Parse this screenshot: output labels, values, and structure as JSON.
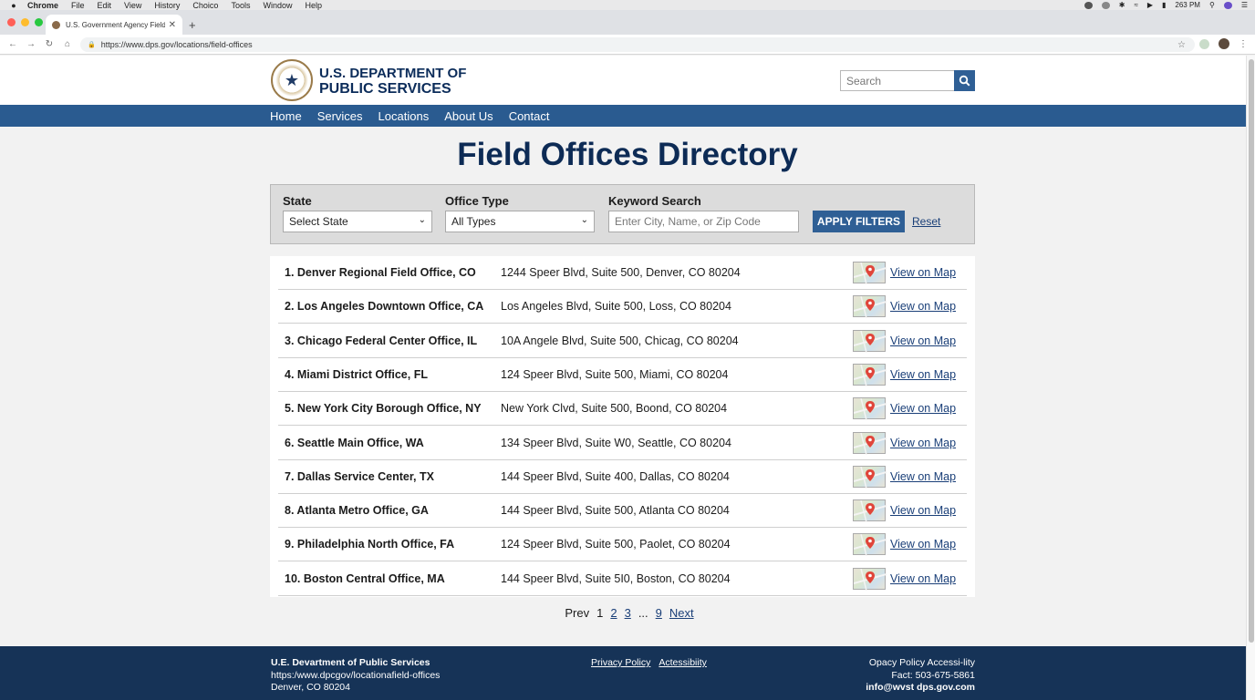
{
  "os_menubar": {
    "app": "Chrome",
    "items": [
      "File",
      "Edit",
      "View",
      "History",
      "Choico",
      "Tools",
      "Window",
      "Help"
    ],
    "clock": "263 PM"
  },
  "browser": {
    "tab_title": "U.S. Government Agency Field",
    "url": "https://www.dps.gov/locations/field-offices"
  },
  "site": {
    "brand_line1": "U.S. DEPARTMENT OF",
    "brand_line2": "PUBLIC SERVICES",
    "search_placeholder": "Search",
    "nav": [
      "Home",
      "Services",
      "Locations",
      "About Us",
      "Contact"
    ]
  },
  "page_title": "Field Offices Directory",
  "filters": {
    "state_label": "State",
    "state_value": "Select State",
    "type_label": "Office Type",
    "type_value": "All Types",
    "keyword_label": "Keyword Search",
    "keyword_placeholder": "Enter City, Name, or Zip Code",
    "apply_label": "APPLY FILTERS",
    "reset_label": "Reset"
  },
  "offices": [
    {
      "name": "1. Denver Regional Field Office, CO",
      "address": "1244 Speer Blvd, Suite 500, Denver, CO 80204",
      "map_label": "View on Map"
    },
    {
      "name": "2. Los Angeles Downtown Office, CA",
      "address": "Los Angeles Blvd, Suite 500, Loss, CO 80204",
      "map_label": "View on Map"
    },
    {
      "name": "3. Chicago Federal Center Office, IL",
      "address": "10A Angele Blvd, Suite 500, Chicag, CO 80204",
      "map_label": "View on Map"
    },
    {
      "name": "4. Miami District Office, FL",
      "address": "124 Speer Blvd, Suite 500, Miami, CO 80204",
      "map_label": "View on Map"
    },
    {
      "name": "5. New York City Borough Office, NY",
      "address": "New York Clvd, Suite 500, Boond, CO 80204",
      "map_label": "View on Map"
    },
    {
      "name": "6. Seattle Main Office, WA",
      "address": "134 Speer Blvd, Suite W0, Seattle, CO 80204",
      "map_label": "View on Map"
    },
    {
      "name": "7. Dallas Service Center, TX",
      "address": "144 Speer Blvd, Suite 400, Dallas, CO 80204",
      "map_label": "View on Map"
    },
    {
      "name": "8. Atlanta Metro Office, GA",
      "address": "144 Speer Blvd, Suite 500, Atlanta CO 80204",
      "map_label": "View on Map"
    },
    {
      "name": "9. Philadelphia North Office, FA",
      "address": "124 Speer Blvd, Suite 500, Paolet, CO 80204",
      "map_label": "View on Map"
    },
    {
      "name": "10. Boston Central Office, MA",
      "address": "144 Speer Blvd, Suite 5I0, Boston, CO 80204",
      "map_label": "View on Map"
    }
  ],
  "pagination": {
    "prev": "Prev",
    "pages": [
      "1",
      "2",
      "3",
      "...",
      "9"
    ],
    "next": "Next"
  },
  "footer": {
    "org": "U.E. Devartment of Public Services",
    "url": "https:/www.dpcgov/locationafield-offices",
    "city": "Denver, CO 80204",
    "privacy": "Privacy Policy",
    "accessibility": "Actessibiity",
    "right_links": "Opacy Policy  Accessi-lity",
    "fax": "Fact: 503-675-5861",
    "email": "info@wvst dps.gov.com"
  },
  "colors": {
    "nav_bar": "#2a5b90",
    "title": "#0d2b55",
    "button": "#2f5f95",
    "footer": "#163357",
    "link": "#1a3f78"
  }
}
